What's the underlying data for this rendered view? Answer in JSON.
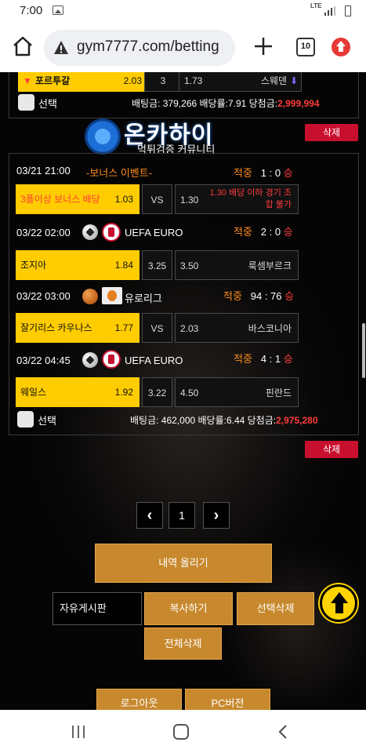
{
  "status": {
    "time": "7:00",
    "network": "LTE"
  },
  "browser": {
    "url": "gym7777.com/betting",
    "tab_count": "10"
  },
  "card1": {
    "row": {
      "home": "포르투갈",
      "home_odds": "2.03",
      "draw": "3",
      "away_odds": "1.73",
      "away": "스웨덴"
    },
    "select_label": "선택",
    "summary_prefix": "배팅금: 379,266 배당률:7.91 당첨금:",
    "payout": "2,999,994",
    "delete_label": "삭제"
  },
  "logo": {
    "title": "온카하이",
    "subtitle": "먹튀검증 커뮤니티"
  },
  "card2": {
    "matches": [
      {
        "time": "03/21 21:00",
        "league": "-보너스 이벤트-",
        "result_label": "적중",
        "score": "1 : 0",
        "outcome": "승",
        "home": "3폴이상 보너스 배당",
        "home_odds": "1.03",
        "draw": "VS",
        "away_odds": "1.30",
        "away": "1.30 배당 이하 경기 조합 불가"
      },
      {
        "time": "03/22 02:00",
        "league": "UEFA EURO",
        "result_label": "적중",
        "score": "2 : 0",
        "outcome": "승",
        "home": "조지아",
        "home_odds": "1.84",
        "draw": "3.25",
        "away_odds": "3.50",
        "away": "룩셈부르크"
      },
      {
        "time": "03/22 03:00",
        "league": "유로리그",
        "result_label": "적중",
        "score": "94 : 76",
        "outcome": "승",
        "home": "잘기리스 카우나스",
        "home_odds": "1.77",
        "draw": "VS",
        "away_odds": "2.03",
        "away": "바스코니아"
      },
      {
        "time": "03/22 04:45",
        "league": "UEFA EURO",
        "result_label": "적중",
        "score": "4 : 1",
        "outcome": "승",
        "home": "웨일스",
        "home_odds": "1.92",
        "draw": "3.22",
        "away_odds": "4.50",
        "away": "핀란드"
      }
    ],
    "select_label": "선택",
    "summary_prefix": "배팅금: 462,000 배당률:6.44 당첨금:",
    "payout": "2,975,280",
    "delete_label": "삭제"
  },
  "pagination": {
    "prev": "‹",
    "current": "1",
    "next": "›"
  },
  "actions": {
    "upload": "내역 올리기",
    "board": "자유게시판",
    "copy": "복사하기",
    "delete_selected": "선택삭제",
    "delete_all": "전체삭제",
    "logout": "로그아웃",
    "pc_version": "PC버전"
  },
  "colors": {
    "accent_yellow": "#ffcc00",
    "gold_button": "#c8892e",
    "delete_red": "#c8102e",
    "win_red": "#ff3c3c"
  }
}
